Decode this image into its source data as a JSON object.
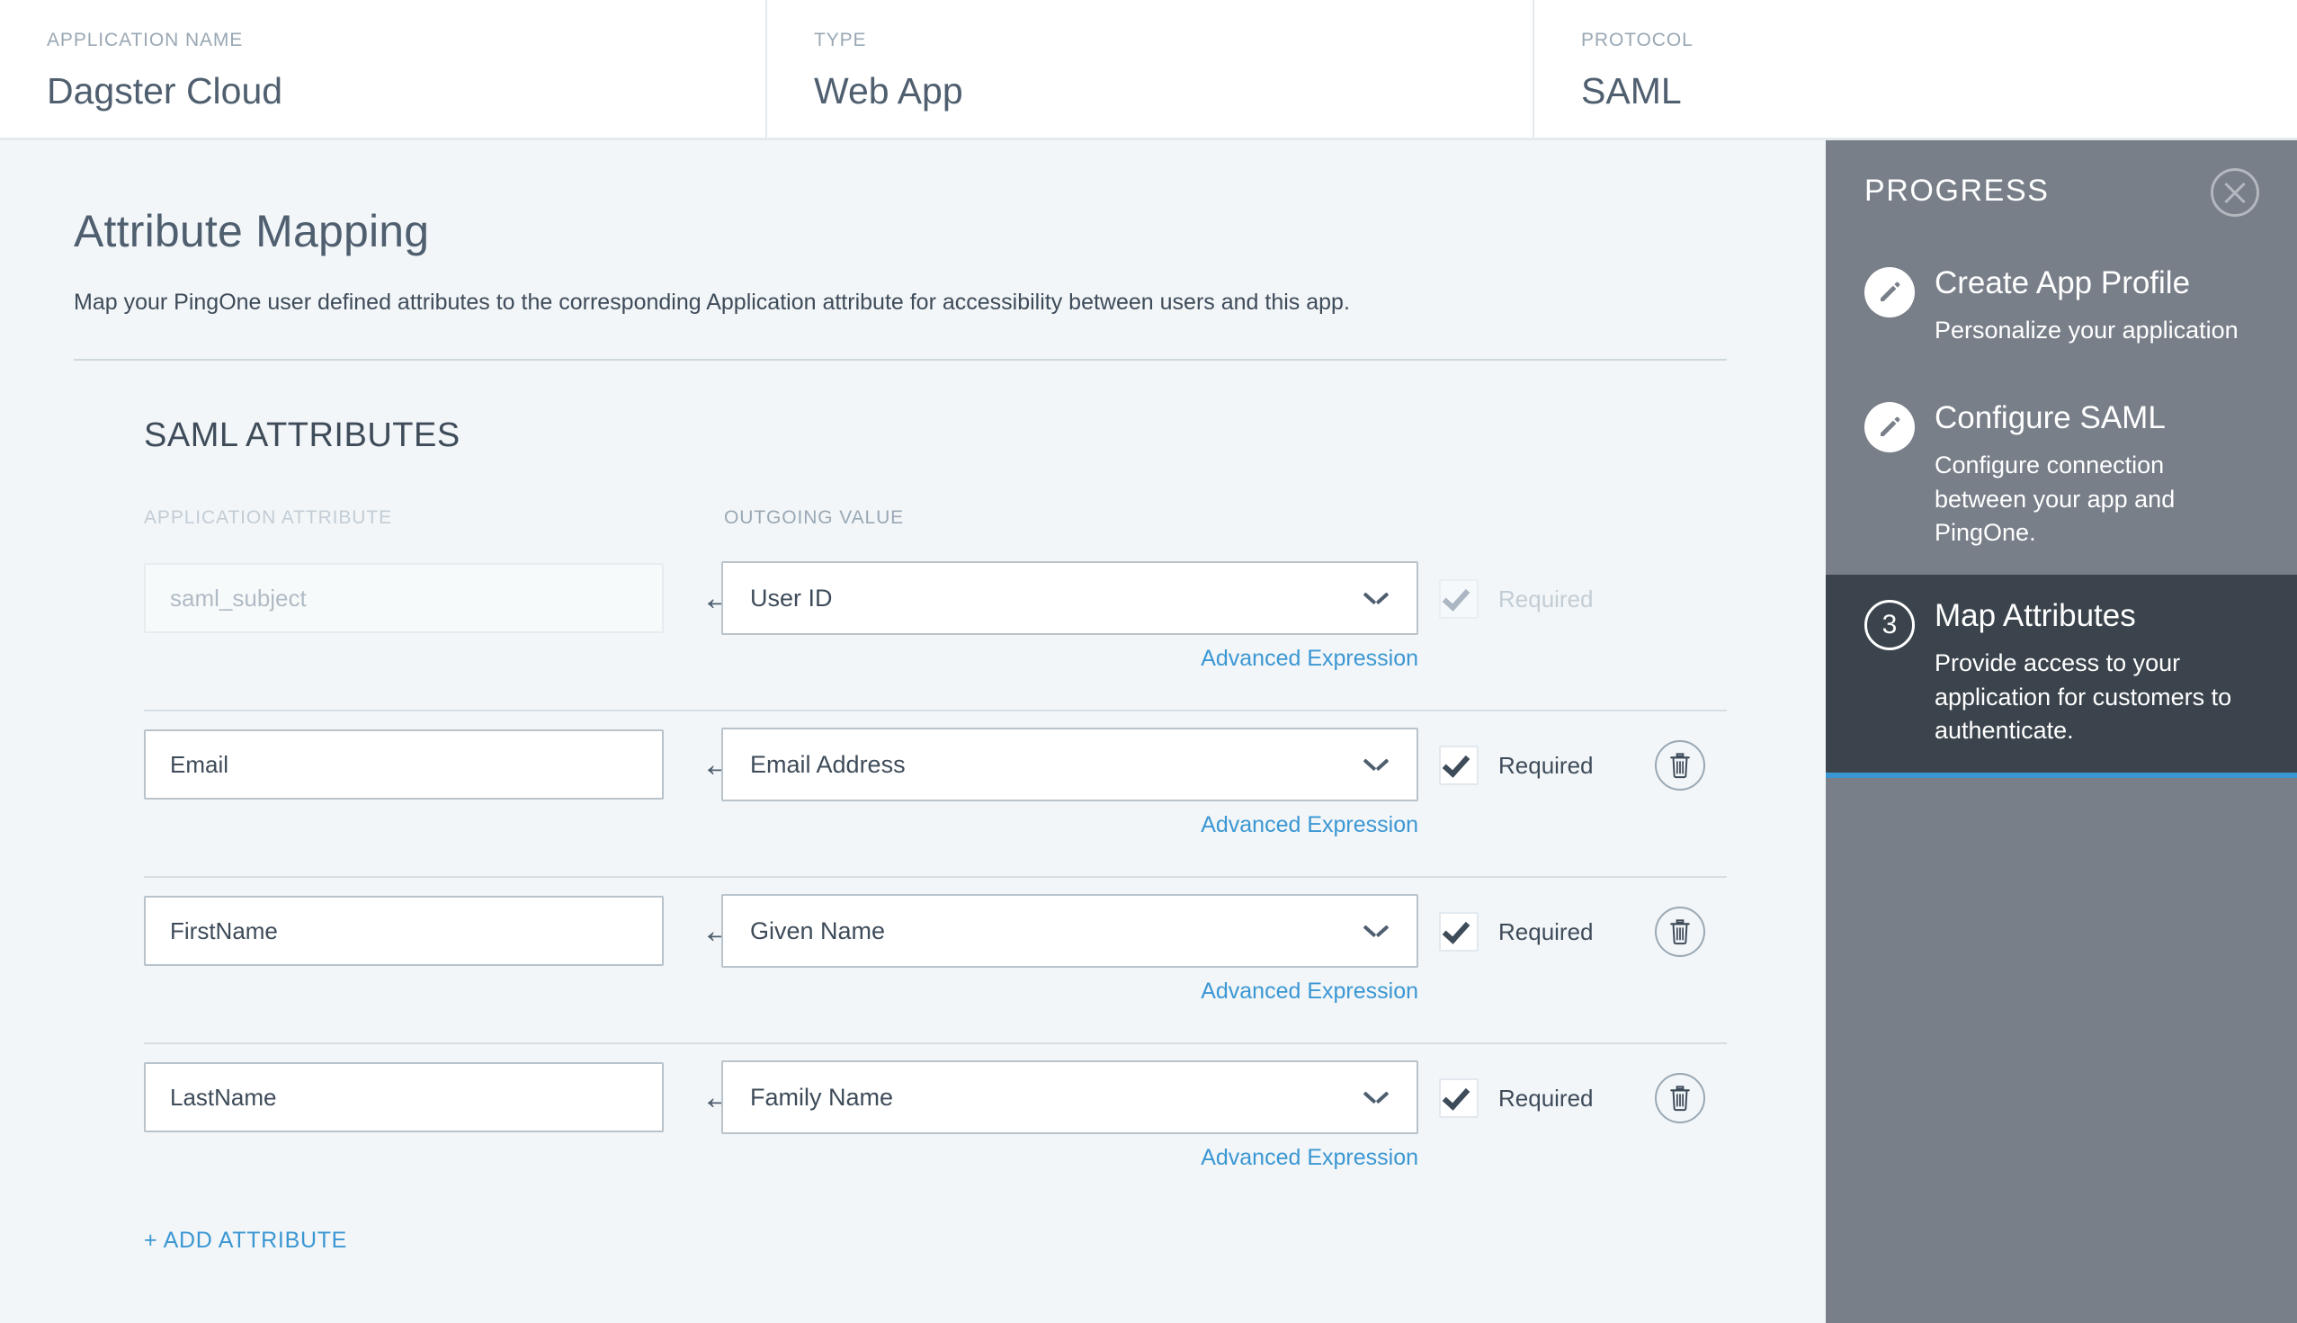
{
  "header": {
    "fields": [
      {
        "label": "APPLICATION NAME",
        "value": "Dagster Cloud"
      },
      {
        "label": "TYPE",
        "value": "Web App"
      },
      {
        "label": "PROTOCOL",
        "value": "SAML"
      }
    ]
  },
  "main": {
    "page_title": "Attribute Mapping",
    "page_subtitle": "Map your PingOne user defined attributes to the corresponding Application attribute for accessibility between users and this app.",
    "section_title": "SAML ATTRIBUTES",
    "columns": {
      "application_attribute": "APPLICATION ATTRIBUTE",
      "outgoing_value": "OUTGOING VALUE"
    },
    "arrow_glyph": "←",
    "advanced_expression_label": "Advanced Expression",
    "required_label": "Required",
    "add_attribute_label": "+ ADD ATTRIBUTE",
    "rows": [
      {
        "application_attribute": "saml_subject",
        "outgoing_value": "User ID",
        "required": true,
        "disabled": true,
        "deletable": false
      },
      {
        "application_attribute": "Email",
        "outgoing_value": "Email Address",
        "required": true,
        "disabled": false,
        "deletable": true
      },
      {
        "application_attribute": "FirstName",
        "outgoing_value": "Given Name",
        "required": true,
        "disabled": false,
        "deletable": true
      },
      {
        "application_attribute": "LastName",
        "outgoing_value": "Family Name",
        "required": true,
        "disabled": false,
        "deletable": true
      }
    ]
  },
  "progress": {
    "title": "PROGRESS",
    "close_icon": "close-icon",
    "steps": [
      {
        "icon": "pencil-icon",
        "marker": "",
        "label": "Create App Profile",
        "description": "Personalize your application",
        "active": false
      },
      {
        "icon": "pencil-icon",
        "marker": "",
        "label": "Configure SAML",
        "description": "Configure connection between your app and PingOne.",
        "active": false
      },
      {
        "icon": "step-number",
        "marker": "3",
        "label": "Map Attributes",
        "description": "Provide access to your application for customers to authenticate.",
        "active": true
      }
    ]
  },
  "colors": {
    "accent_blue": "#3b97d3",
    "panel_bg": "#f2f6f8",
    "sidebar_bg": "#787f89",
    "sidebar_active_bg": "#3b444d",
    "text_dark": "#3e4b59",
    "text_muted": "#9aa8b4"
  }
}
